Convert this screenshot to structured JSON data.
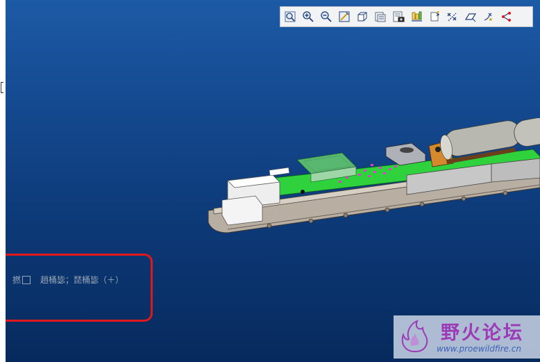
{
  "toolbar": {
    "buttons": [
      {
        "icon": "zoom-fit-icon"
      },
      {
        "icon": "zoom-in-icon"
      },
      {
        "icon": "zoom-out-icon"
      },
      {
        "icon": "repaint-icon"
      },
      {
        "icon": "display-style-icon"
      },
      {
        "icon": "saved-views-icon"
      },
      {
        "icon": "view-manager-icon"
      },
      {
        "icon": "layers-icon"
      },
      {
        "icon": "spin-center-icon"
      },
      {
        "icon": "datum-display-icon"
      },
      {
        "icon": "plane-display-icon"
      },
      {
        "icon": "point-display-icon"
      },
      {
        "icon": "csys-display-icon"
      }
    ]
  },
  "status": {
    "label": "撚",
    "text": "趙桶毖；琵桶毖（＋）"
  },
  "colors": {
    "viewport_top": "#1d5aa6",
    "viewport_bottom": "#072a5d",
    "callout": "#e2171b",
    "status_text": "#9aa6b6"
  },
  "watermark": {
    "title": "野火论坛",
    "url": "www.proewildfire.cn"
  }
}
